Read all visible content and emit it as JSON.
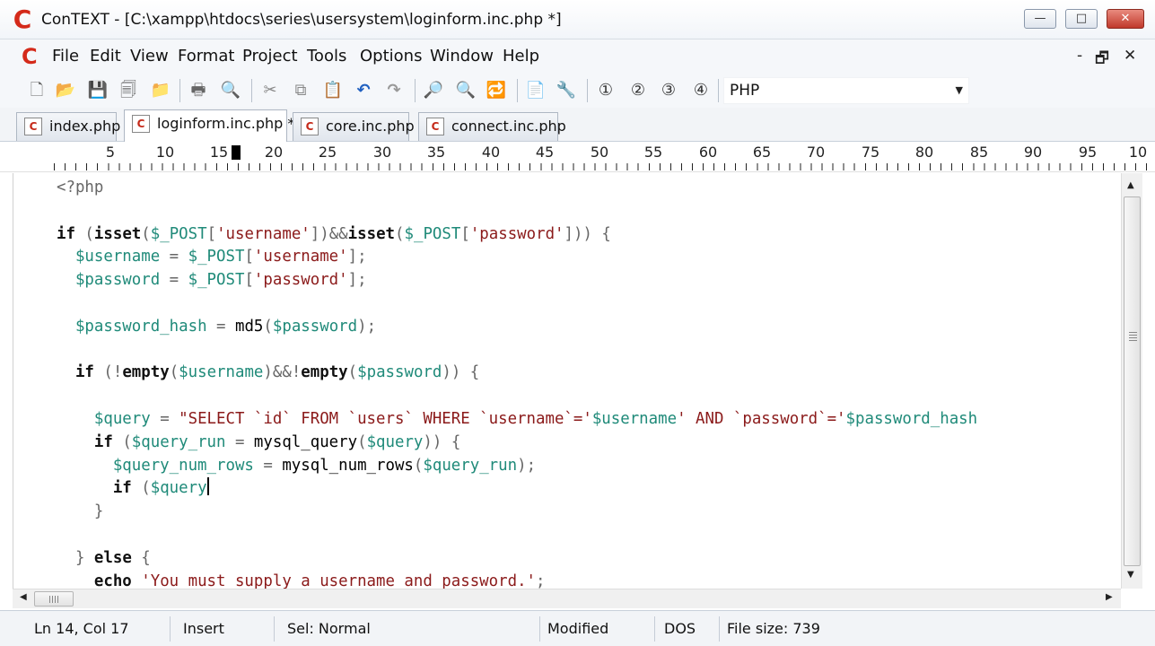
{
  "window": {
    "title": "ConTEXT - [C:\\xampp\\htdocs\\series\\usersystem\\loginform.inc.php *]",
    "logo_letter": "C",
    "minimize": "—",
    "maximize": "□",
    "close": "✕"
  },
  "menu": {
    "items": [
      "File",
      "Edit",
      "View",
      "Format",
      "Project",
      "Tools",
      "Options",
      "Window",
      "Help"
    ],
    "mdi_minimize": "-",
    "mdi_restore": "🗗",
    "mdi_close": "✕"
  },
  "toolbar": {
    "icons": [
      "new-file-icon",
      "open-folder-icon",
      "save-icon",
      "save-all-icon",
      "open-project-icon",
      "print-icon",
      "print-preview-icon",
      "cut-icon",
      "copy-icon",
      "paste-icon",
      "undo-icon",
      "redo-icon",
      "find-icon",
      "find-next-icon",
      "replace-icon",
      "export-icon",
      "tools-icon",
      "user-command-1-icon",
      "user-command-2-icon",
      "user-command-3-icon",
      "user-command-4-icon"
    ],
    "glyphs": [
      "🗋",
      "📂",
      "💾",
      "🗐",
      "📁",
      "🖶",
      "🔍",
      "✂",
      "⧉",
      "📋",
      "↶",
      "↷",
      "🔎",
      "🔍",
      "🔁",
      "📄",
      "🔧",
      "①",
      "②",
      "③",
      "④"
    ],
    "language": "PHP"
  },
  "tabs": [
    {
      "label": "index.php",
      "active": false
    },
    {
      "label": "loginform.inc.php *",
      "active": true
    },
    {
      "label": "core.inc.php",
      "active": false
    },
    {
      "label": "connect.inc.php",
      "active": false
    }
  ],
  "ruler": {
    "numbers": [
      "5",
      "10",
      "15",
      "20",
      "25",
      "30",
      "35",
      "40",
      "45",
      "50",
      "55",
      "60",
      "65",
      "70",
      "75",
      "80",
      "85",
      "90",
      "95",
      "10"
    ]
  },
  "code": {
    "l1": "<?php",
    "l3a": "if",
    "l3b": "isset",
    "l3c": "$_POST",
    "l3d": "'username'",
    "l3e": "isset",
    "l3f": "$_POST",
    "l3g": "'password'",
    "l4a": "$username",
    "l4b": "$_POST",
    "l4c": "'username'",
    "l5a": "$password",
    "l5b": "$_POST",
    "l5c": "'password'",
    "l7a": "$password_hash",
    "l7b": "md5",
    "l7c": "$password",
    "l9a": "if",
    "l9b": "empty",
    "l9c": "$username",
    "l9d": "empty",
    "l9e": "$password",
    "l11a": "$query",
    "l11b": "\"SELECT `id` FROM `users` WHERE `username`='",
    "l11c": "$username",
    "l11d": "' AND `password`='",
    "l11e": "$password_hash",
    "l12a": "if",
    "l12b": "$query_run",
    "l12c": "mysql_query",
    "l12d": "$query",
    "l13a": "$query_num_rows",
    "l13b": "mysql_num_rows",
    "l13c": "$query_run",
    "l14a": "if",
    "l14b": "$query",
    "l17a": "else",
    "l18a": "echo",
    "l18b": "'You must supply a username and password.'"
  },
  "status": {
    "position": "Ln 14, Col 17",
    "mode": "Insert",
    "selection": "Sel: Normal",
    "modified": "Modified",
    "line_endings": "DOS",
    "file_size": "File size: 739"
  }
}
